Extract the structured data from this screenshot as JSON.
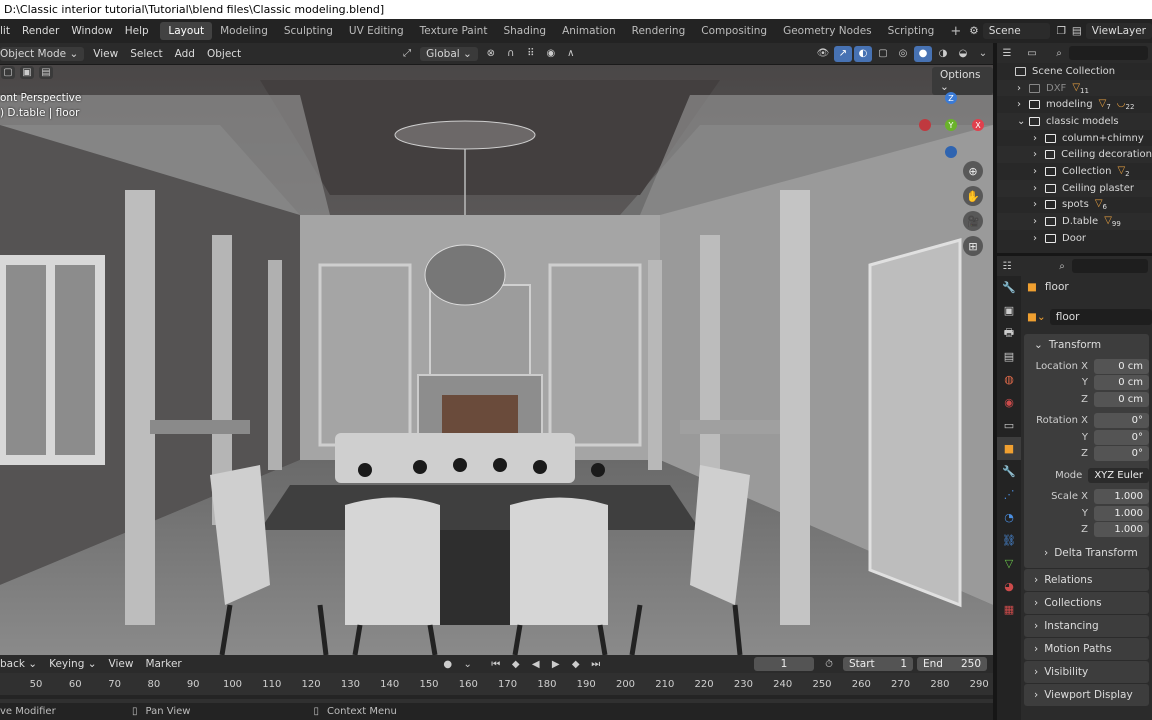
{
  "window": {
    "title": "D:\\Classic interior tutorial\\Tutorial\\blend files\\Classic modeling.blend]"
  },
  "menu": {
    "edit": "lit",
    "render": "Render",
    "window": "Window",
    "help": "Help"
  },
  "workspaces": [
    "Layout",
    "Modeling",
    "Sculpting",
    "UV Editing",
    "Texture Paint",
    "Shading",
    "Animation",
    "Rendering",
    "Compositing",
    "Geometry Nodes",
    "Scripting"
  ],
  "workspace_add": "+",
  "scene": {
    "name": "Scene",
    "view_layer": "ViewLayer"
  },
  "viewport_header": {
    "mode": "Object Mode",
    "menus": [
      "View",
      "Select",
      "Add",
      "Object"
    ],
    "orientation": "Global"
  },
  "viewport": {
    "view_name": "ont Perspective",
    "object_info": ") D.table | floor",
    "options": "Options",
    "gizmo": {
      "z": "Z",
      "y": "Y",
      "x": "X"
    },
    "colors": {
      "x_axis": "#e0404d",
      "y_axis": "#6ab32a",
      "z_axis": "#3b7bd6",
      "accent": "#4772b3"
    }
  },
  "timeline": {
    "menus": [
      "back",
      "Keying",
      "View",
      "Marker"
    ],
    "current_frame": "1",
    "start_label": "Start",
    "start_value": "1",
    "end_label": "End",
    "end_value": "250",
    "ticks": [
      "50",
      "60",
      "70",
      "80",
      "90",
      "100",
      "110",
      "120",
      "130",
      "140",
      "150",
      "160",
      "170",
      "180",
      "190",
      "200",
      "210",
      "220",
      "230",
      "240",
      "250",
      "260",
      "270",
      "280",
      "290"
    ]
  },
  "statusbar": {
    "left": "ve Modifier",
    "middle": "Pan View",
    "right": "Context Menu"
  },
  "outliner": {
    "root": "Scene Collection",
    "items": [
      {
        "name": "DXF",
        "badge": "11",
        "level": 1,
        "dim": true
      },
      {
        "name": "modeling",
        "badge": "7",
        "badge2": "22",
        "level": 1
      },
      {
        "name": "classic models",
        "level": 1,
        "expanded": true
      },
      {
        "name": "column+chimny",
        "level": 2
      },
      {
        "name": "Ceiling decoration",
        "level": 2
      },
      {
        "name": "Collection",
        "badge": "2",
        "level": 2
      },
      {
        "name": "Ceiling plaster",
        "level": 2
      },
      {
        "name": "spots",
        "badge": "6",
        "level": 2
      },
      {
        "name": "D.table",
        "badge": "99",
        "level": 2
      },
      {
        "name": "Door",
        "level": 2
      }
    ]
  },
  "properties": {
    "object_name": "floor",
    "data_name": "floor",
    "transform_label": "Transform",
    "location": {
      "label_x": "Location X",
      "y_label": "Y",
      "z_label": "Z",
      "x": "0 cm",
      "y": "0 cm",
      "z": "0 cm"
    },
    "rotation": {
      "label_x": "Rotation X",
      "y_label": "Y",
      "z_label": "Z",
      "x": "0°",
      "y": "0°",
      "z": "0°"
    },
    "mode": {
      "label": "Mode",
      "value": "XYZ Euler"
    },
    "scale": {
      "label_x": "Scale X",
      "y_label": "Y",
      "z_label": "Z",
      "x": "1.000",
      "y": "1.000",
      "z": "1.000"
    },
    "delta_transform": "Delta Transform",
    "panels": [
      "Relations",
      "Collections",
      "Instancing",
      "Motion Paths",
      "Visibility",
      "Viewport Display"
    ]
  }
}
